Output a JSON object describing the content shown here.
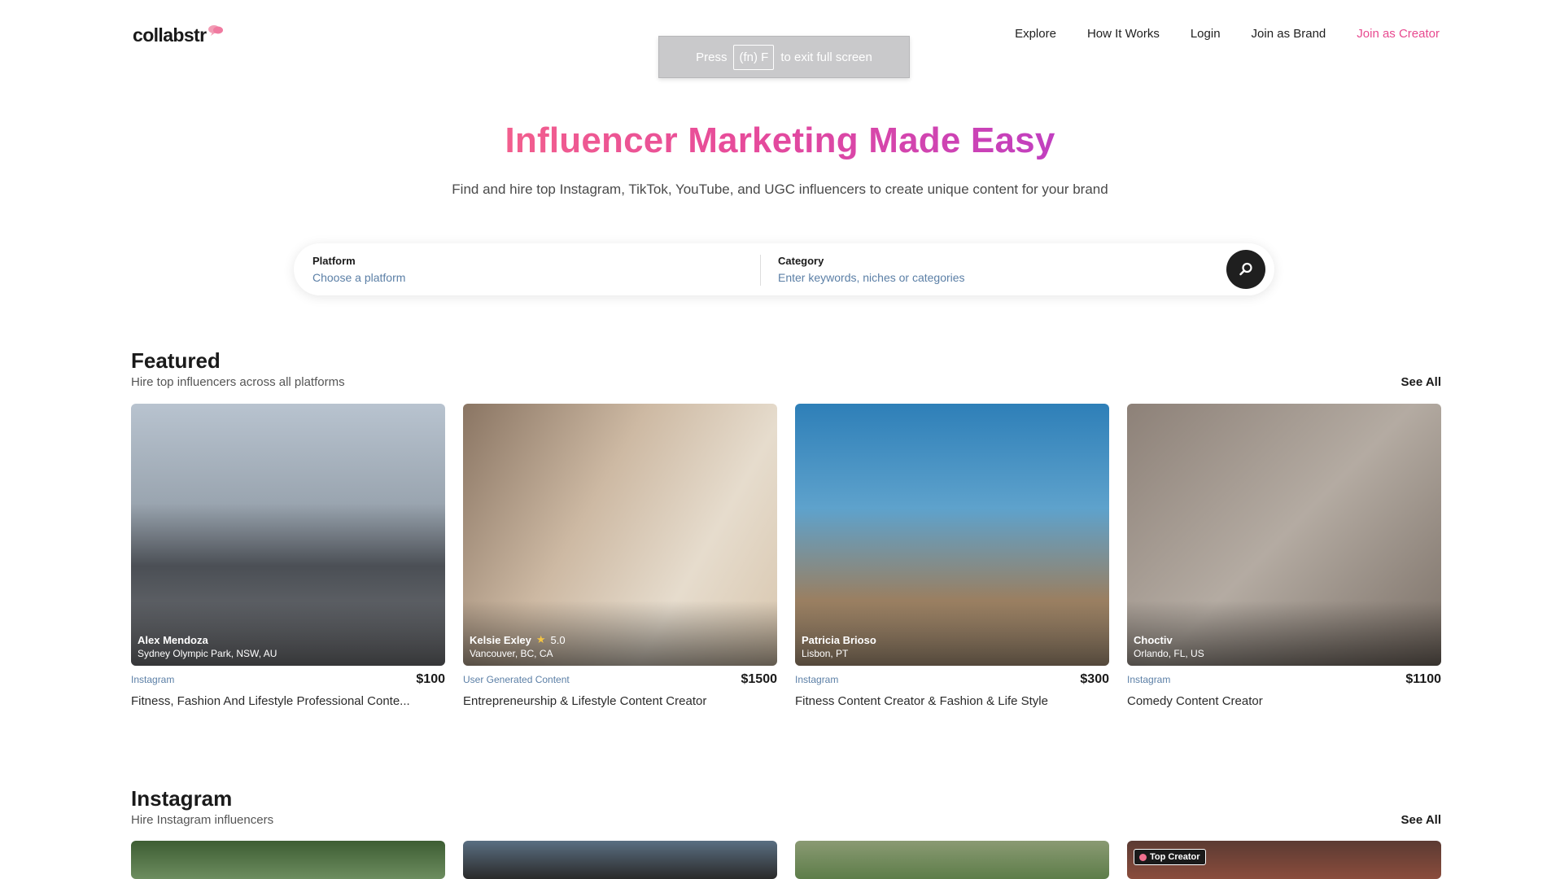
{
  "brand": {
    "name": "collabstr",
    "accent": "#e8498f"
  },
  "nav": {
    "explore": "Explore",
    "how": "How It Works",
    "login": "Login",
    "brand": "Join as Brand",
    "creator": "Join as Creator"
  },
  "toast": {
    "press": "Press",
    "key": "(fn) F",
    "rest": "to exit full screen"
  },
  "hero": {
    "title": "Influencer Marketing Made Easy",
    "subtitle": "Find and hire top Instagram, TikTok, YouTube, and UGC influencers to create unique content for your brand"
  },
  "search": {
    "platform_label": "Platform",
    "platform_placeholder": "Choose a platform",
    "category_label": "Category",
    "category_placeholder": "Enter keywords, niches or categories",
    "button_icon": "search-icon"
  },
  "featured": {
    "title": "Featured",
    "subtitle": "Hire top influencers across all platforms",
    "see_all": "See All",
    "cards": [
      {
        "name": "Alex Mendoza",
        "location": "Sydney Olympic Park, NSW, AU",
        "platform": "Instagram",
        "price": "$100",
        "description": "Fitness, Fashion And Lifestyle Professional Conte..."
      },
      {
        "name": "Kelsie Exley",
        "rating": "5.0",
        "location": "Vancouver, BC, CA",
        "platform": "User Generated Content",
        "price": "$1500",
        "description": "Entrepreneurship & Lifestyle Content Creator"
      },
      {
        "name": "Patricia Brioso",
        "location": "Lisbon, PT",
        "platform": "Instagram",
        "price": "$300",
        "description": "Fitness Content Creator & Fashion & Life Style"
      },
      {
        "name": "Choctiv",
        "location": "Orlando, FL, US",
        "platform": "Instagram",
        "price": "$1100",
        "description": "Comedy Content Creator"
      }
    ]
  },
  "instagram": {
    "title": "Instagram",
    "subtitle": "Hire Instagram influencers",
    "see_all": "See All",
    "badge": "Top Creator"
  }
}
